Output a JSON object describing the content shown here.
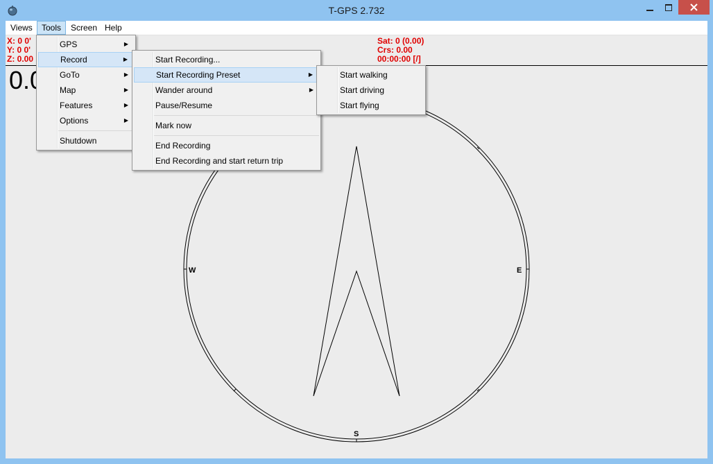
{
  "window": {
    "title": "T-GPS 2.732",
    "minimize_label": "minimize",
    "maximize_label": "maximize",
    "close_label": "close"
  },
  "menubar": {
    "items": [
      "Views",
      "Tools",
      "Screen",
      "Help"
    ]
  },
  "readout": {
    "x": "X: 0 0'",
    "y": "Y: 0 0'",
    "z": "Z: 0.00",
    "sat": "Sat: 0 (0.00)",
    "crs": "Crs: 0.00",
    "time": "00:00:00 [/]",
    "speed": "0.0"
  },
  "compass": {
    "n": "",
    "w": "W",
    "e": "E",
    "s": "S"
  },
  "tools_menu": {
    "items": [
      "GPS",
      "Record",
      "GoTo",
      "Map",
      "Features",
      "Options",
      "Shutdown"
    ]
  },
  "record_menu": {
    "items": [
      "Start Recording...",
      "Start Recording Preset",
      "Wander around",
      "Pause/Resume",
      "Mark now",
      "End Recording",
      "End Recording and start return trip"
    ]
  },
  "preset_menu": {
    "items": [
      "Start walking",
      "Start driving",
      "Start flying"
    ]
  },
  "colors": {
    "readout": "#e00000",
    "titlebar": "#8fc3f0",
    "highlight": "#d5e6f7"
  }
}
